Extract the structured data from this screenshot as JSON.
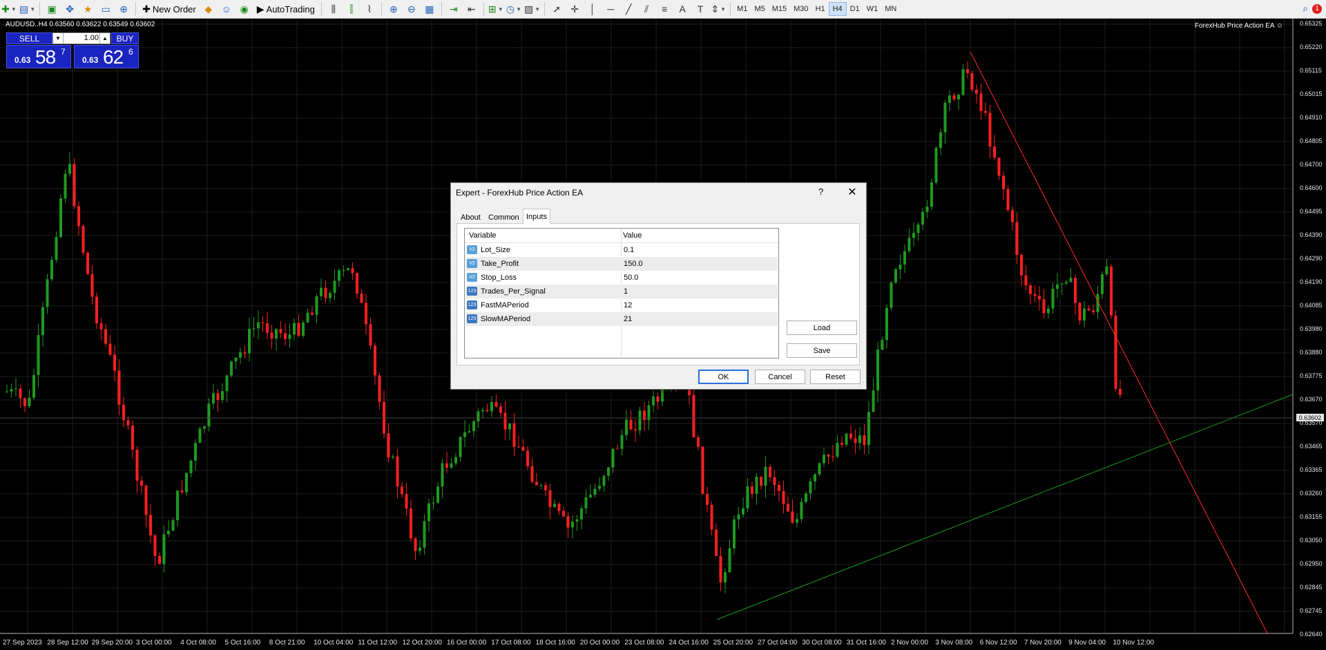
{
  "toolbar": {
    "new_order": "New Order",
    "autotrading": "AutoTrading",
    "timeframes": [
      "M1",
      "M5",
      "M15",
      "M30",
      "H1",
      "H4",
      "D1",
      "W1",
      "MN"
    ],
    "active_timeframe": "H4",
    "notification_count": "1"
  },
  "chart": {
    "title": "AUDUSD..H4  0.63560 0.63622 0.63549 0.63602",
    "ea_label": "ForexHub Price Action EA ☺",
    "current_price": "0.63602",
    "price_labels": [
      "0.65325",
      "0.65220",
      "0.65115",
      "0.65015",
      "0.64910",
      "0.64805",
      "0.64700",
      "0.64600",
      "0.64495",
      "0.64390",
      "0.64290",
      "0.64190",
      "0.64085",
      "0.63980",
      "0.63880",
      "0.63775",
      "0.63670",
      "0.63570",
      "0.63465",
      "0.63365",
      "0.63260",
      "0.63155",
      "0.63050",
      "0.62950",
      "0.62845",
      "0.62745",
      "0.62640"
    ],
    "time_labels": [
      "27 Sep 2023",
      "28 Sep 12:00",
      "29 Sep 20:00",
      "3 Oct 00:00",
      "4 Oct 08:00",
      "5 Oct 16:00",
      "8 Oct 21:00",
      "10 Oct 04:00",
      "11 Oct 12:00",
      "12 Oct 20:00",
      "16 Oct 00:00",
      "17 Oct 08:00",
      "18 Oct 16:00",
      "20 Oct 00:00",
      "23 Oct 08:00",
      "24 Oct 16:00",
      "25 Oct 20:00",
      "27 Oct 04:00",
      "30 Oct 08:00",
      "31 Oct 16:00",
      "2 Nov 00:00",
      "3 Nov 08:00",
      "6 Nov 12:00",
      "7 Nov 20:00",
      "9 Nov 04:00",
      "10 Nov 12:00"
    ],
    "colors": {
      "bull": "#1f9a1f",
      "bear": "#ff2020",
      "grid": "#1e1e1e",
      "background": "#000000"
    }
  },
  "trade_panel": {
    "sell_label": "SELL",
    "buy_label": "BUY",
    "lot": "1.00",
    "sell_small": "0.63",
    "sell_big": "58",
    "sell_sup": "7",
    "buy_small": "0.63",
    "buy_big": "62",
    "buy_sup": "6"
  },
  "dialog": {
    "title": "Expert - ForexHub Price Action EA",
    "help": "?",
    "close": "✕",
    "tabs": [
      "About",
      "Common",
      "Inputs"
    ],
    "active_tab": "Inputs",
    "columns": [
      "Variable",
      "Value"
    ],
    "inputs": [
      {
        "name": "Lot_Size",
        "value": "0.1",
        "type": "V2"
      },
      {
        "name": "Take_Profit",
        "value": "150.0",
        "type": "V2"
      },
      {
        "name": "Stop_Loss",
        "value": "50.0",
        "type": "V2"
      },
      {
        "name": "Trades_Per_Signal",
        "value": "1",
        "type": "123"
      },
      {
        "name": "FastMAPeriod",
        "value": "12",
        "type": "123"
      },
      {
        "name": "SlowMAPeriod",
        "value": "21",
        "type": "123"
      }
    ],
    "load_label": "Load",
    "save_label": "Save",
    "ok_label": "OK",
    "cancel_label": "Cancel",
    "reset_label": "Reset"
  }
}
